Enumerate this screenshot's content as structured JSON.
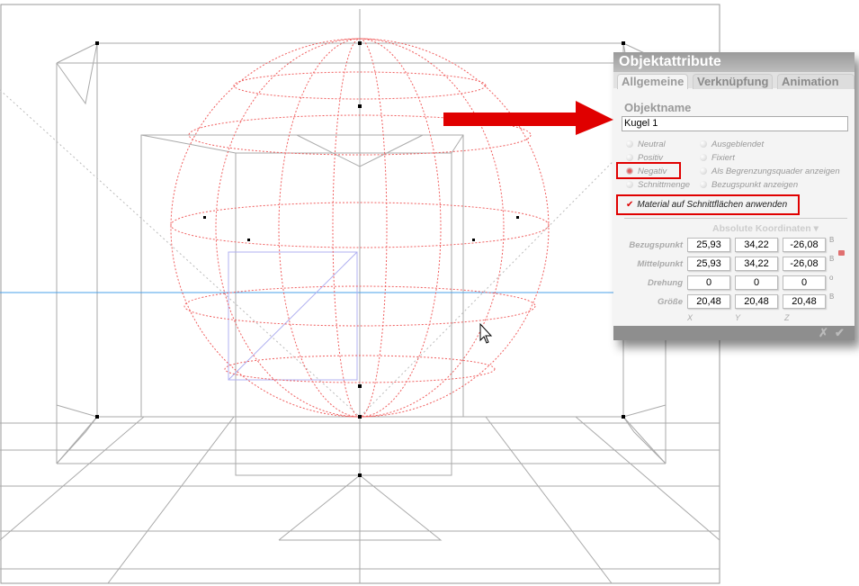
{
  "dialog": {
    "title": "Objektattribute",
    "tabs": [
      "Allgemeine",
      "Verknüpfung",
      "Animation"
    ],
    "object_name_label": "Objektname",
    "object_name_value": "Kugel 1",
    "radios_left": [
      "Neutral",
      "Positiv",
      "Negativ",
      "Schnittmenge"
    ],
    "radios_right": [
      "Ausgeblendet",
      "Fixiert",
      "Als Begrenzungsquader anzeigen",
      "Bezugspunkt anzeigen"
    ],
    "selected_radio": "Negativ",
    "checkbox_label": "Material auf Schnittflächen anwenden",
    "checkbox_checked": true,
    "coord_mode": "Absolute Koordinaten",
    "rows": [
      {
        "label": "Bezugspunkt",
        "x": "25,93",
        "y": "34,22",
        "z": "-26,08",
        "unit": "B"
      },
      {
        "label": "Mittelpunkt",
        "x": "25,93",
        "y": "34,22",
        "z": "-26,08",
        "unit": "B"
      },
      {
        "label": "Drehung",
        "x": "0",
        "y": "0",
        "z": "0",
        "unit": "o"
      },
      {
        "label": "Größe",
        "x": "20,48",
        "y": "20,48",
        "z": "20,48",
        "unit": "B"
      }
    ],
    "axes": [
      "X",
      "Y",
      "Z"
    ],
    "cancel_icon": "✗",
    "ok_icon": "✔"
  },
  "colors": {
    "highlight": "#e00000",
    "sphere": "#f06060",
    "axis_line": "#4aa0e8"
  }
}
